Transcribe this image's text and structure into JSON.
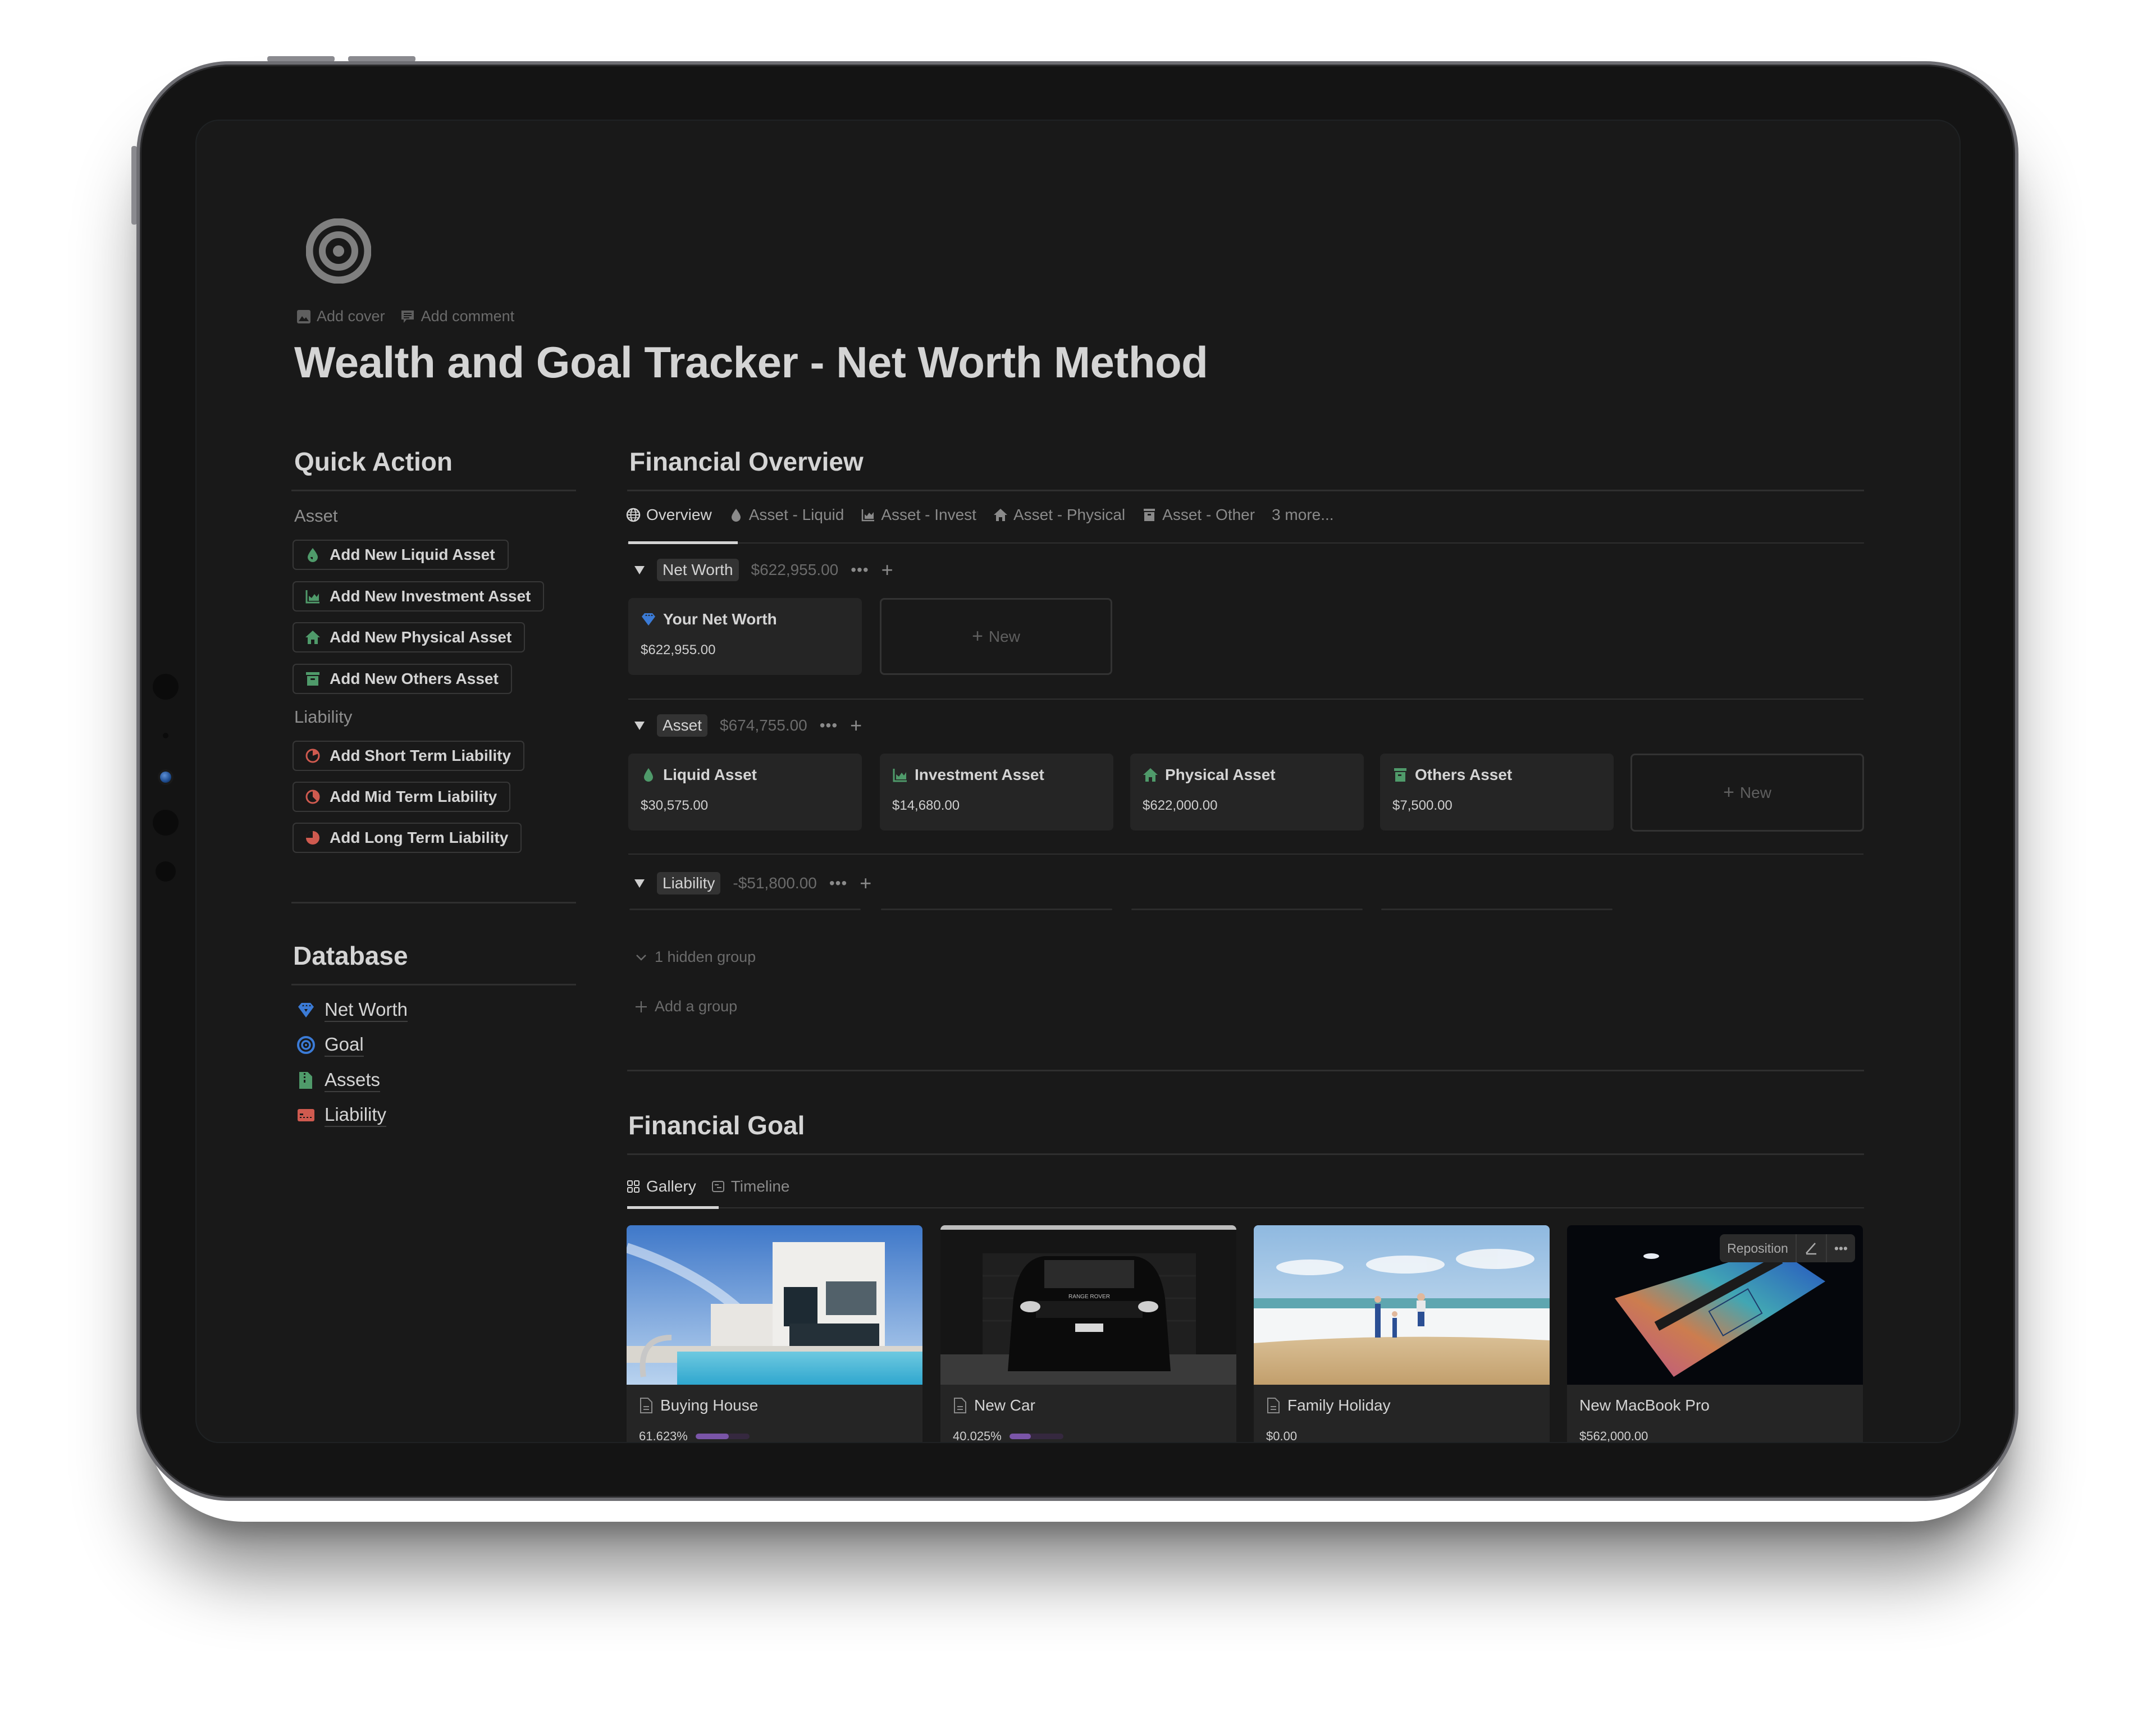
{
  "page": {
    "icon": "target-icon",
    "add_cover": "Add cover",
    "add_comment": "Add comment",
    "title": "Wealth and Goal Tracker - Net Worth Method"
  },
  "quick_action": {
    "heading": "Quick Action",
    "asset_label": "Asset",
    "asset_buttons": [
      {
        "label": "Add New Liquid Asset",
        "icon": "droplet-icon"
      },
      {
        "label": "Add New Investment Asset",
        "icon": "chart-icon"
      },
      {
        "label": "Add New Physical Asset",
        "icon": "house-icon"
      },
      {
        "label": "Add New Others Asset",
        "icon": "archive-box-icon"
      }
    ],
    "liability_label": "Liability",
    "liability_buttons": [
      {
        "label": "Add Short Term Liability",
        "icon": "pie-quarter-icon"
      },
      {
        "label": "Add Mid Term Liability",
        "icon": "pie-half-icon"
      },
      {
        "label": "Add Long Term Liability",
        "icon": "pie-three-quarter-icon"
      }
    ]
  },
  "database": {
    "heading": "Database",
    "items": [
      {
        "label": "Net Worth",
        "icon": "diamond-icon"
      },
      {
        "label": "Goal",
        "icon": "target-icon"
      },
      {
        "label": "Assets",
        "icon": "file-zipper-icon"
      },
      {
        "label": "Liability",
        "icon": "credit-card-icon"
      }
    ]
  },
  "overview": {
    "heading": "Financial Overview",
    "tabs": [
      {
        "label": "Overview",
        "icon": "globe-icon",
        "active": true
      },
      {
        "label": "Asset - Liquid",
        "icon": "droplet-icon"
      },
      {
        "label": "Asset - Invest",
        "icon": "chart-icon"
      },
      {
        "label": "Asset - Physical",
        "icon": "house-icon"
      },
      {
        "label": "Asset - Other",
        "icon": "archive-box-icon"
      },
      {
        "label": "3 more..."
      }
    ],
    "groups": {
      "net_worth": {
        "name": "Net Worth",
        "sum": "$622,955.00",
        "cards": [
          {
            "title": "Your Net Worth",
            "value": "$622,955.00",
            "icon": "diamond-icon"
          }
        ]
      },
      "asset": {
        "name": "Asset",
        "sum": "$674,755.00",
        "cards": [
          {
            "title": "Liquid Asset",
            "value": "$30,575.00",
            "icon": "droplet-icon"
          },
          {
            "title": "Investment Asset",
            "value": "$14,680.00",
            "icon": "chart-icon"
          },
          {
            "title": "Physical Asset",
            "value": "$622,000.00",
            "icon": "house-icon"
          },
          {
            "title": "Others Asset",
            "value": "$7,500.00",
            "icon": "archive-box-icon"
          }
        ]
      },
      "liability": {
        "name": "Liability",
        "sum": "-$51,800.00"
      }
    },
    "new_label": "New",
    "hidden_groups": "1 hidden group",
    "add_group": "Add a group",
    "more_glyph": "•••",
    "plus_glyph": "+"
  },
  "goals": {
    "heading": "Financial Goal",
    "tabs": [
      {
        "label": "Gallery",
        "icon": "gallery-grid-icon",
        "active": true
      },
      {
        "label": "Timeline",
        "icon": "timeline-icon"
      }
    ],
    "cards": [
      {
        "title": "Buying House",
        "value": "61.623%",
        "progress": 0.61623,
        "image": "modern-house-pool",
        "show_page_icon": true
      },
      {
        "title": "New Car",
        "value": "40.025%",
        "progress": 0.40025,
        "image": "black-range-rover",
        "show_page_icon": true
      },
      {
        "title": "Family Holiday",
        "value": "$0.00",
        "image": "family-beach",
        "show_page_icon": true
      },
      {
        "title": "New MacBook Pro",
        "value": "$562,000.00",
        "image": "laptop-dark",
        "show_page_icon": false
      }
    ],
    "hover_tools": {
      "reposition": "Reposition"
    }
  },
  "colors": {
    "asset_green": "#4f9a6a",
    "liability_red": "#cf5a4f",
    "accent_blue": "#3b7bd6",
    "progress_purple": "#7a55a8",
    "background": "#191919",
    "card": "#252525"
  }
}
